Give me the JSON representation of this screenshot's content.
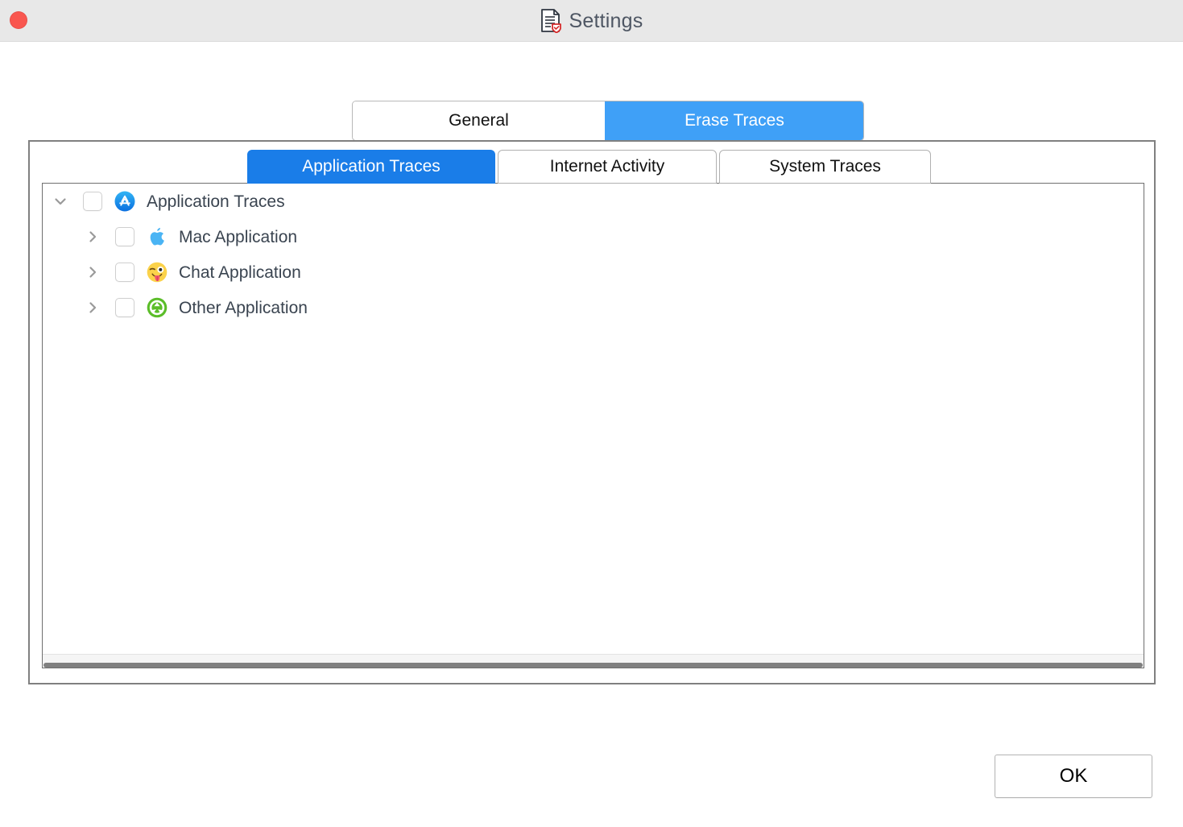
{
  "window": {
    "title": "Settings",
    "title_icon": "document-shield-icon",
    "close_button": "close-icon",
    "titlebar_color": "#e8e8e8",
    "body_color": "#ffffff"
  },
  "accent": {
    "outer_tab_active": "#3fa0f7",
    "inner_tab_active": "#1a7de8",
    "close_button": "#f9564f",
    "label_text": "#3a4450"
  },
  "outer_tabs": [
    {
      "label": "General",
      "active": false
    },
    {
      "label": "Erase Traces",
      "active": true
    }
  ],
  "inner_tabs": [
    {
      "label": "Application Traces",
      "active": true
    },
    {
      "label": "Internet Activity",
      "active": false
    },
    {
      "label": "System Traces",
      "active": false
    }
  ],
  "tree": {
    "root": {
      "label": "Application Traces",
      "icon": "app-store-icon",
      "expanded": true,
      "checked": false
    },
    "children": [
      {
        "label": "Mac Application",
        "icon": "apple-logo-icon",
        "expanded": false,
        "checked": false
      },
      {
        "label": "Chat Application",
        "icon": "winking-tongue-face-icon",
        "expanded": false,
        "checked": false
      },
      {
        "label": "Other Application",
        "icon": "green-recycle-icon",
        "expanded": false,
        "checked": false
      }
    ]
  },
  "footer": {
    "ok_label": "OK"
  }
}
